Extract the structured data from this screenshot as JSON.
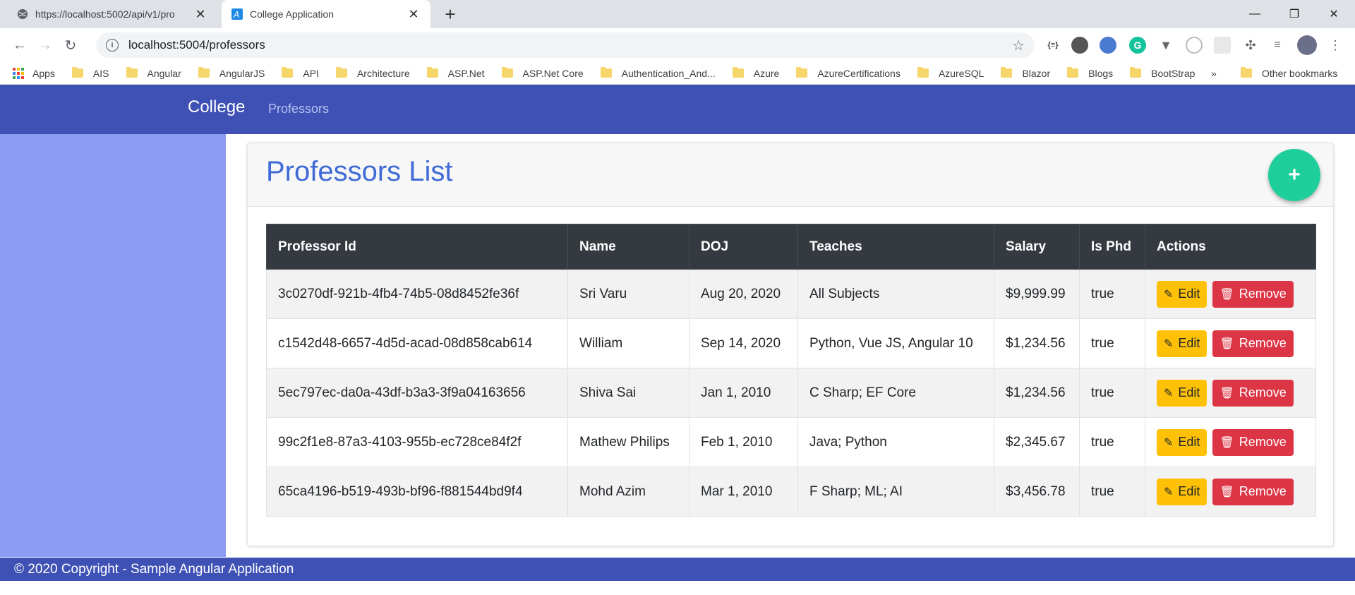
{
  "browser": {
    "tabs": [
      {
        "title": "https://localhost:5002/api/v1/pro",
        "icon": "globe-icon"
      },
      {
        "title": "College Application",
        "icon": "angular-a-icon"
      }
    ],
    "url": "localhost:5004/professors",
    "bookmarks": [
      "Apps",
      "AIS",
      "Angular",
      "AngularJS",
      "API",
      "Architecture",
      "ASP.Net",
      "ASP.Net Core",
      "Authentication_And...",
      "Azure",
      "AzureCertifications",
      "AzureSQL",
      "Blazor",
      "Blogs",
      "BootStrap"
    ],
    "more_bookmarks": "»",
    "other_bookmarks": "Other bookmarks"
  },
  "navbar": {
    "brand": "College",
    "link": "Professors",
    "color": "#3f51b5"
  },
  "page": {
    "title": "Professors List",
    "add_label": "+"
  },
  "table": {
    "headers": [
      "Professor Id",
      "Name",
      "DOJ",
      "Teaches",
      "Salary",
      "Is Phd",
      "Actions"
    ],
    "rows": [
      {
        "id": "3c0270df-921b-4fb4-74b5-08d8452fe36f",
        "name": "Sri Varu",
        "doj": "Aug 20, 2020",
        "teaches": "All Subjects",
        "salary": "$9,999.99",
        "phd": "true"
      },
      {
        "id": "c1542d48-6657-4d5d-acad-08d858cab614",
        "name": "William",
        "doj": "Sep 14, 2020",
        "teaches": "Python, Vue JS, Angular 10",
        "salary": "$1,234.56",
        "phd": "true"
      },
      {
        "id": "5ec797ec-da0a-43df-b3a3-3f9a04163656",
        "name": "Shiva Sai",
        "doj": "Jan 1, 2010",
        "teaches": "C Sharp; EF Core",
        "salary": "$1,234.56",
        "phd": "true"
      },
      {
        "id": "99c2f1e8-87a3-4103-955b-ec728ce84f2f",
        "name": "Mathew Philips",
        "doj": "Feb 1, 2010",
        "teaches": "Java; Python",
        "salary": "$2,345.67",
        "phd": "true"
      },
      {
        "id": "65ca4196-b519-493b-bf96-f881544bd9f4",
        "name": "Mohd Azim",
        "doj": "Mar 1, 2010",
        "teaches": "F Sharp; ML; AI",
        "salary": "$3,456.78",
        "phd": "true"
      }
    ],
    "edit_label": "Edit",
    "remove_label": "Remove"
  },
  "footer": {
    "text": "© 2020 Copyright - Sample Angular Application"
  }
}
